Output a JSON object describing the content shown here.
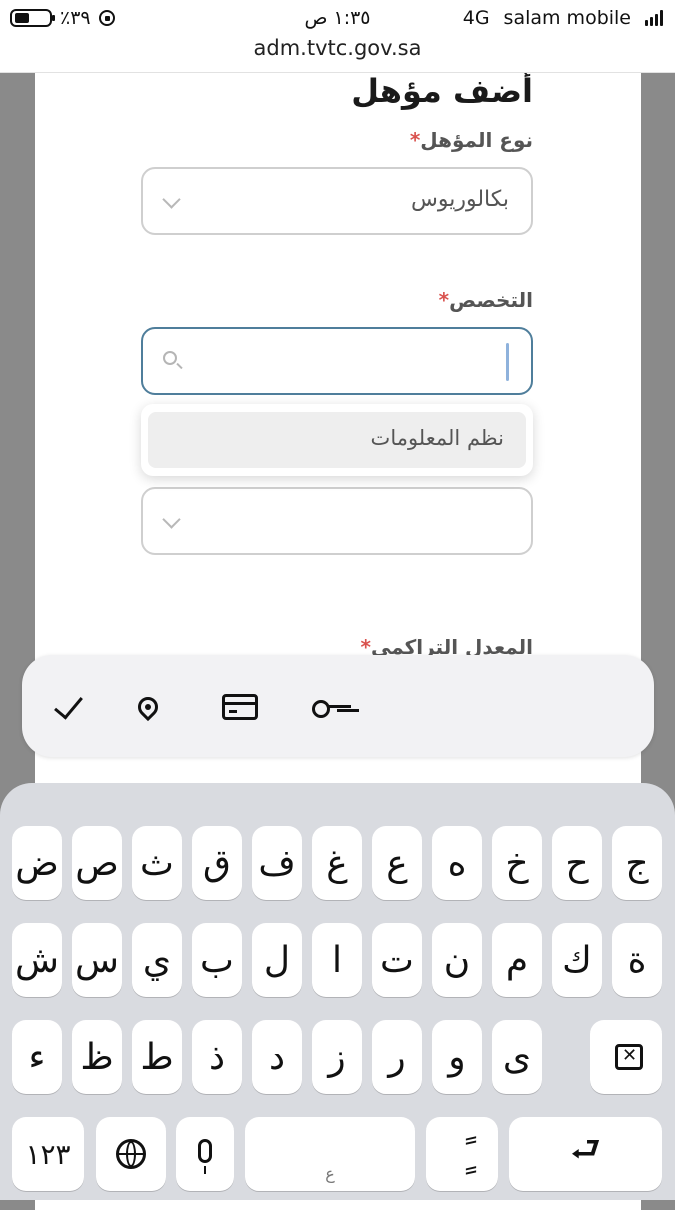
{
  "status_bar": {
    "battery": "٪٣٩",
    "time": "١:٣٥ ص",
    "network": "4G",
    "carrier": "salam mobile",
    "url": "adm.tvtc.gov.sa"
  },
  "form": {
    "heading": "أضف مؤهل",
    "required_mark": "*",
    "qualification_type": {
      "label": "نوع المؤهل",
      "value": "بكالوريوس"
    },
    "specialization": {
      "label": "التخصص",
      "search_value": "",
      "options": [
        "نظم المعلومات"
      ]
    },
    "third_select": {
      "value": ""
    },
    "gpa": {
      "label": "المعدل التراكمي"
    }
  },
  "autofill_bar": {
    "items": [
      "check-icon",
      "location-pin-icon",
      "credit-card-icon",
      "key-icon"
    ]
  },
  "keyboard": {
    "row1": [
      "ض",
      "ص",
      "ث",
      "ق",
      "ف",
      "غ",
      "ع",
      "ه",
      "خ",
      "ح",
      "ج"
    ],
    "row2": [
      "ش",
      "س",
      "ي",
      "ب",
      "ل",
      "ا",
      "ت",
      "ن",
      "م",
      "ك",
      "ة"
    ],
    "row3": [
      "ء",
      "ظ",
      "ط",
      "ذ",
      "د",
      "ز",
      "ر",
      "و",
      "ى"
    ],
    "numbers_key": "١٢٣",
    "space_hint": "ع",
    "diacritic_key": "ًٍ",
    "return_key": "⮐"
  }
}
